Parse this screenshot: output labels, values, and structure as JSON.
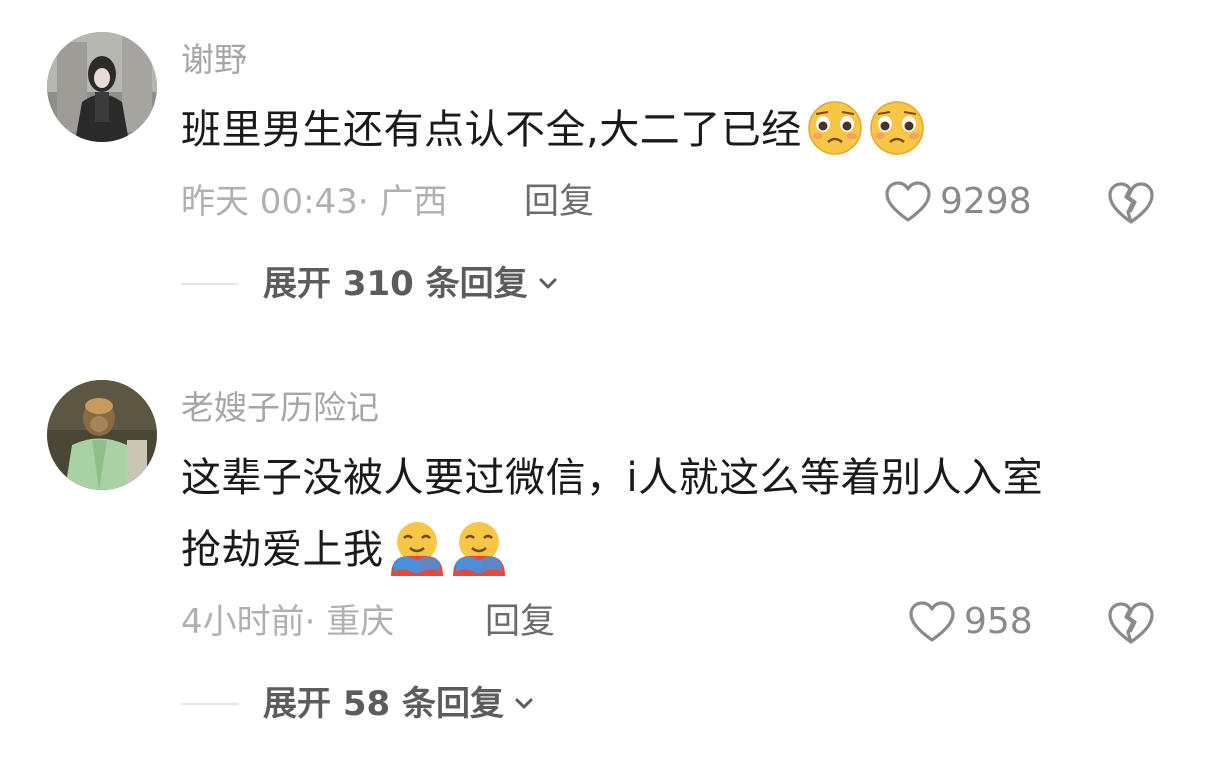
{
  "comments": [
    {
      "username": "谢野",
      "text_line1": "班里男生还有点认不全,大二了已经",
      "text_line2": "",
      "emoji_icon": "pleading-face-icon",
      "time": "昨天 00:43",
      "location": "· 广西",
      "reply_label": "回复",
      "like_count": "9298",
      "expand_label": "展开 310 条回复"
    },
    {
      "username": "老嫂子历险记",
      "text_line1": "这辈子没被人要过微信，i人就这么等着别人入室",
      "text_line2": "抢劫爱上我",
      "emoji_icon": "hugging-face-icon",
      "time": "4小时前",
      "location": "· 重庆",
      "reply_label": "回复",
      "like_count": "958",
      "expand_label": "展开 58 条回复"
    }
  ],
  "colors": {
    "username": "#a6a6a6",
    "text": "#1a1a1a",
    "meta": "#b0b0b0",
    "reply": "#6b6b6b",
    "icon": "#8a8a8a"
  }
}
